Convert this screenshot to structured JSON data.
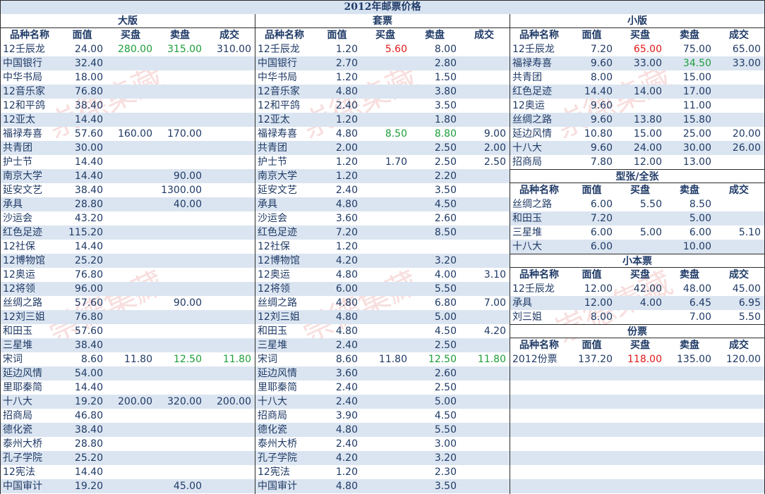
{
  "title": "2012年邮票价格",
  "headers": {
    "name": "品种名称",
    "face": "面值",
    "buy": "买盘",
    "sell": "卖盘",
    "deal": "成交"
  },
  "colors": {
    "green": "#1e9e3a",
    "red": "#e01a1a",
    "stripe": "#dbe5f1"
  },
  "sections": {
    "dab": {
      "title": "大版",
      "rows": [
        {
          "name": "12壬辰龙",
          "face": "24.00",
          "buy": "280.00",
          "sell": "315.00",
          "deal": "310.00",
          "buyColor": "green",
          "sellColor": "green"
        },
        {
          "name": "中国银行",
          "face": "32.40",
          "buy": "",
          "sell": "",
          "deal": ""
        },
        {
          "name": "中华书局",
          "face": "18.00",
          "buy": "",
          "sell": "",
          "deal": ""
        },
        {
          "name": "12音乐家",
          "face": "76.80",
          "buy": "",
          "sell": "",
          "deal": ""
        },
        {
          "name": "12和平鸽",
          "face": "38.40",
          "buy": "",
          "sell": "",
          "deal": ""
        },
        {
          "name": "12亚太",
          "face": "14.40",
          "buy": "",
          "sell": "",
          "deal": ""
        },
        {
          "name": "福禄寿喜",
          "face": "57.60",
          "buy": "160.00",
          "sell": "170.00",
          "deal": ""
        },
        {
          "name": "共青团",
          "face": "30.00",
          "buy": "",
          "sell": "",
          "deal": ""
        },
        {
          "name": "护士节",
          "face": "14.40",
          "buy": "",
          "sell": "",
          "deal": ""
        },
        {
          "name": "南京大学",
          "face": "14.40",
          "buy": "",
          "sell": "90.00",
          "deal": ""
        },
        {
          "name": "延安文艺",
          "face": "38.40",
          "buy": "",
          "sell": "1300.00",
          "deal": ""
        },
        {
          "name": "承具",
          "face": "28.80",
          "buy": "",
          "sell": "40.00",
          "deal": ""
        },
        {
          "name": "沙运会",
          "face": "43.20",
          "buy": "",
          "sell": "",
          "deal": ""
        },
        {
          "name": "红色足迹",
          "face": "115.20",
          "buy": "",
          "sell": "",
          "deal": ""
        },
        {
          "name": "12社保",
          "face": "14.40",
          "buy": "",
          "sell": "",
          "deal": ""
        },
        {
          "name": "12博物馆",
          "face": "25.20",
          "buy": "",
          "sell": "",
          "deal": ""
        },
        {
          "name": "12奥运",
          "face": "76.80",
          "buy": "",
          "sell": "",
          "deal": ""
        },
        {
          "name": "12将领",
          "face": "96.00",
          "buy": "",
          "sell": "",
          "deal": ""
        },
        {
          "name": "丝绸之路",
          "face": "57.60",
          "buy": "",
          "sell": "90.00",
          "deal": ""
        },
        {
          "name": "12刘三姐",
          "face": "76.80",
          "buy": "",
          "sell": "",
          "deal": ""
        },
        {
          "name": "和田玉",
          "face": "57.60",
          "buy": "",
          "sell": "",
          "deal": ""
        },
        {
          "name": "三星堆",
          "face": "38.40",
          "buy": "",
          "sell": "",
          "deal": ""
        },
        {
          "name": "宋词",
          "face": "8.60",
          "buy": "11.80",
          "sell": "12.50",
          "deal": "11.80",
          "sellColor": "green",
          "dealColor": "green"
        },
        {
          "name": "延边风情",
          "face": "54.00",
          "buy": "",
          "sell": "",
          "deal": ""
        },
        {
          "name": "里耶秦简",
          "face": "14.40",
          "buy": "",
          "sell": "",
          "deal": ""
        },
        {
          "name": "十八大",
          "face": "19.20",
          "buy": "200.00",
          "sell": "320.00",
          "deal": "200.00"
        },
        {
          "name": "招商局",
          "face": "46.80",
          "buy": "",
          "sell": "",
          "deal": ""
        },
        {
          "name": "德化瓷",
          "face": "38.40",
          "buy": "",
          "sell": "",
          "deal": ""
        },
        {
          "name": "泰州大桥",
          "face": "28.80",
          "buy": "",
          "sell": "",
          "deal": ""
        },
        {
          "name": "孔子学院",
          "face": "25.20",
          "buy": "",
          "sell": "",
          "deal": ""
        },
        {
          "name": "12宪法",
          "face": "14.40",
          "buy": "",
          "sell": "",
          "deal": ""
        },
        {
          "name": "中国审计",
          "face": "19.20",
          "buy": "",
          "sell": "45.00",
          "deal": ""
        }
      ]
    },
    "taop": {
      "title": "套票",
      "rows": [
        {
          "name": "12壬辰龙",
          "face": "1.20",
          "buy": "5.60",
          "sell": "8.00",
          "deal": "",
          "buyColor": "red"
        },
        {
          "name": "中国银行",
          "face": "2.70",
          "buy": "",
          "sell": "2.80",
          "deal": ""
        },
        {
          "name": "中华书局",
          "face": "1.20",
          "buy": "",
          "sell": "1.50",
          "deal": ""
        },
        {
          "name": "12音乐家",
          "face": "4.80",
          "buy": "",
          "sell": "3.80",
          "deal": ""
        },
        {
          "name": "12和平鸽",
          "face": "2.40",
          "buy": "",
          "sell": "3.50",
          "deal": ""
        },
        {
          "name": "12亚太",
          "face": "1.20",
          "buy": "",
          "sell": "1.80",
          "deal": ""
        },
        {
          "name": "福禄寿喜",
          "face": "4.80",
          "buy": "8.50",
          "sell": "8.80",
          "deal": "9.00",
          "buyColor": "green",
          "sellColor": "green"
        },
        {
          "name": "共青团",
          "face": "2.00",
          "buy": "",
          "sell": "2.50",
          "deal": "2.00"
        },
        {
          "name": "护士节",
          "face": "1.20",
          "buy": "1.70",
          "sell": "2.50",
          "deal": "2.50"
        },
        {
          "name": "南京大学",
          "face": "1.20",
          "buy": "",
          "sell": "2.20",
          "deal": ""
        },
        {
          "name": "延安文艺",
          "face": "2.40",
          "buy": "",
          "sell": "3.50",
          "deal": ""
        },
        {
          "name": "承具",
          "face": "4.80",
          "buy": "",
          "sell": "4.50",
          "deal": ""
        },
        {
          "name": "沙运会",
          "face": "3.60",
          "buy": "",
          "sell": "2.60",
          "deal": ""
        },
        {
          "name": "红色足迹",
          "face": "7.20",
          "buy": "",
          "sell": "8.50",
          "deal": ""
        },
        {
          "name": "12社保",
          "face": "1.20",
          "buy": "",
          "sell": "",
          "deal": ""
        },
        {
          "name": "12博物馆",
          "face": "4.20",
          "buy": "",
          "sell": "3.20",
          "deal": ""
        },
        {
          "name": "12奥运",
          "face": "4.80",
          "buy": "",
          "sell": "4.00",
          "deal": "3.10"
        },
        {
          "name": "12将领",
          "face": "6.00",
          "buy": "",
          "sell": "5.50",
          "deal": ""
        },
        {
          "name": "丝绸之路",
          "face": "4.80",
          "buy": "",
          "sell": "6.80",
          "deal": "7.00"
        },
        {
          "name": "12刘三姐",
          "face": "4.80",
          "buy": "",
          "sell": "5.00",
          "deal": ""
        },
        {
          "name": "和田玉",
          "face": "4.80",
          "buy": "",
          "sell": "4.50",
          "deal": "4.20"
        },
        {
          "name": "三星堆",
          "face": "2.40",
          "buy": "",
          "sell": "2.50",
          "deal": ""
        },
        {
          "name": "宋词",
          "face": "8.60",
          "buy": "11.80",
          "sell": "12.50",
          "deal": "11.80",
          "sellColor": "green",
          "dealColor": "green"
        },
        {
          "name": "延边风情",
          "face": "3.60",
          "buy": "",
          "sell": "2.60",
          "deal": ""
        },
        {
          "name": "里耶秦简",
          "face": "2.40",
          "buy": "",
          "sell": "2.50",
          "deal": ""
        },
        {
          "name": "十八大",
          "face": "2.40",
          "buy": "",
          "sell": "5.00",
          "deal": ""
        },
        {
          "name": "招商局",
          "face": "3.90",
          "buy": "",
          "sell": "4.50",
          "deal": ""
        },
        {
          "name": "德化瓷",
          "face": "4.80",
          "buy": "",
          "sell": "5.50",
          "deal": ""
        },
        {
          "name": "泰州大桥",
          "face": "2.40",
          "buy": "",
          "sell": "3.00",
          "deal": ""
        },
        {
          "name": "孔子学院",
          "face": "4.20",
          "buy": "",
          "sell": "3.20",
          "deal": ""
        },
        {
          "name": "12宪法",
          "face": "1.20",
          "buy": "",
          "sell": "2.30",
          "deal": ""
        },
        {
          "name": "中国审计",
          "face": "4.80",
          "buy": "",
          "sell": "3.50",
          "deal": ""
        }
      ]
    },
    "xiaob": {
      "title": "小版",
      "rows": [
        {
          "name": "12壬辰龙",
          "face": "7.20",
          "buy": "65.00",
          "sell": "75.00",
          "deal": "65.00",
          "buyColor": "red"
        },
        {
          "name": "福禄寿喜",
          "face": "9.60",
          "buy": "33.00",
          "sell": "34.50",
          "deal": "33.00",
          "sellColor": "green"
        },
        {
          "name": "共青团",
          "face": "8.00",
          "buy": "",
          "sell": "15.00",
          "deal": ""
        },
        {
          "name": "红色足迹",
          "face": "14.40",
          "buy": "14.00",
          "sell": "17.00",
          "deal": ""
        },
        {
          "name": "12奥运",
          "face": "9.60",
          "buy": "",
          "sell": "11.00",
          "deal": ""
        },
        {
          "name": "丝绸之路",
          "face": "9.60",
          "buy": "13.80",
          "sell": "15.80",
          "deal": ""
        },
        {
          "name": "延边风情",
          "face": "10.80",
          "buy": "15.00",
          "sell": "25.00",
          "deal": "20.00"
        },
        {
          "name": "十八大",
          "face": "9.60",
          "buy": "24.00",
          "sell": "30.00",
          "deal": "26.00"
        },
        {
          "name": "招商局",
          "face": "7.80",
          "buy": "12.00",
          "sell": "13.00",
          "deal": ""
        }
      ]
    },
    "xingz": {
      "title": "型张/全张",
      "rows": [
        {
          "name": "丝绸之路",
          "face": "6.00",
          "buy": "5.50",
          "sell": "8.50",
          "deal": ""
        },
        {
          "name": "和田玉",
          "face": "7.20",
          "buy": "",
          "sell": "5.00",
          "deal": ""
        },
        {
          "name": "三星堆",
          "face": "6.00",
          "buy": "5.00",
          "sell": "6.00",
          "deal": "5.10"
        },
        {
          "name": "十八大",
          "face": "6.00",
          "buy": "",
          "sell": "10.00",
          "deal": ""
        }
      ]
    },
    "xiaoben": {
      "title": "小本票",
      "rows": [
        {
          "name": "12壬辰龙",
          "face": "12.00",
          "buy": "42.00",
          "sell": "48.00",
          "deal": "45.00"
        },
        {
          "name": "承具",
          "face": "12.00",
          "buy": "4.00",
          "sell": "6.45",
          "deal": "6.95"
        },
        {
          "name": "刘三姐",
          "face": "8.00",
          "buy": "",
          "sell": "7.00",
          "deal": "5.50"
        }
      ]
    },
    "fenp": {
      "title": "份票",
      "rows": [
        {
          "name": "2012份票",
          "face": "137.20",
          "buy": "118.00",
          "sell": "135.00",
          "deal": "120.00",
          "buyColor": "red"
        }
      ]
    }
  }
}
